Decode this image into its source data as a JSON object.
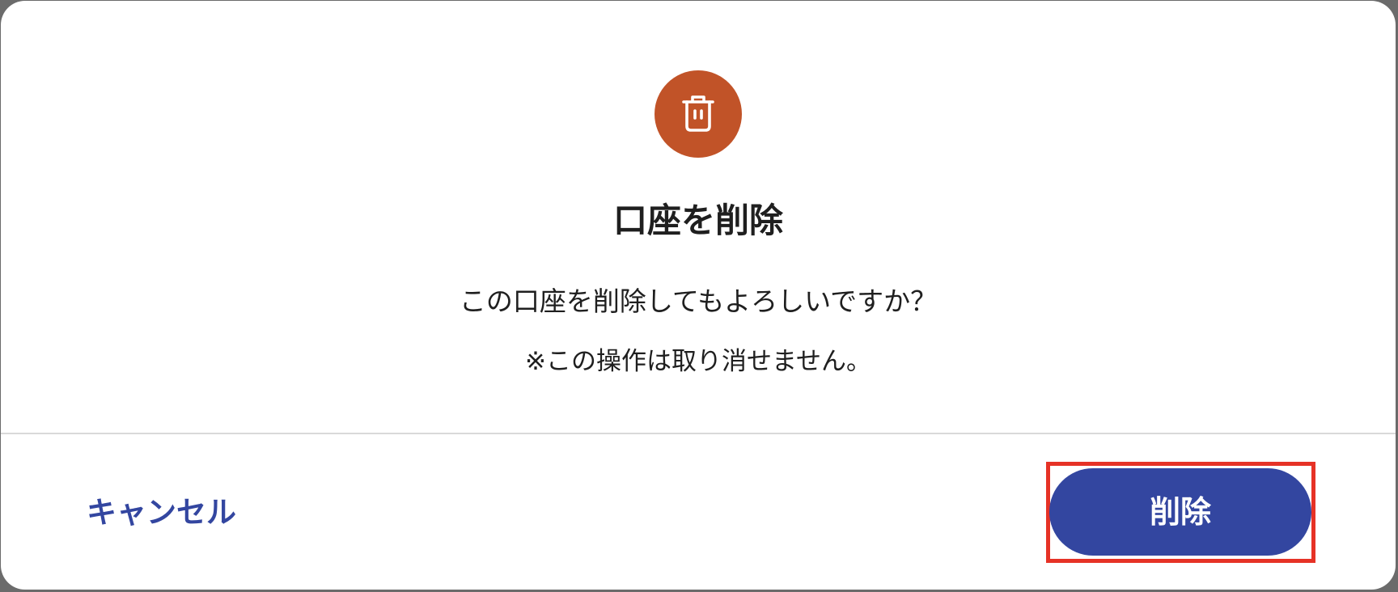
{
  "dialog": {
    "icon": "trash-icon",
    "icon_bg_color": "#c15328",
    "icon_fg_color": "#ffffff",
    "title": "口座を削除",
    "message": "この口座を削除してもよろしいですか？",
    "note": "※この操作は取り消せません。"
  },
  "footer": {
    "cancel_label": "キャンセル",
    "delete_label": "削除",
    "accent_color": "#3346a0",
    "highlight_color": "#e63226"
  }
}
